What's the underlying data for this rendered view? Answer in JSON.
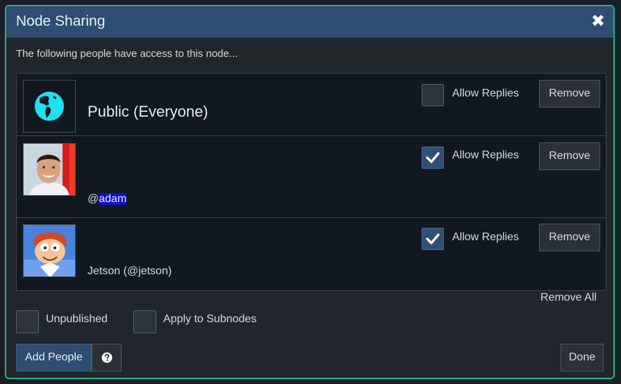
{
  "dialog": {
    "title": "Node Sharing",
    "close_icon": "close-icon",
    "intro": "The following people have access to this node..."
  },
  "shares": [
    {
      "name": "Public (Everyone)",
      "avatar": "globe-icon",
      "allow_replies": false,
      "allow_label": "Allow Replies",
      "remove_label": "Remove"
    },
    {
      "name_prefix": "@",
      "name_highlight": "adam",
      "avatar": "user-photo-adam",
      "allow_replies": true,
      "allow_label": "Allow Replies",
      "remove_label": "Remove"
    },
    {
      "name": "Jetson (@jetson)",
      "avatar": "user-avatar-jetson",
      "allow_replies": true,
      "allow_label": "Allow Replies",
      "remove_label": "Remove"
    }
  ],
  "remove_all_label": "Remove All",
  "options": {
    "unpublished": {
      "label": "Unpublished",
      "checked": false
    },
    "apply_subnodes": {
      "label": "Apply to Subnodes",
      "checked": false
    }
  },
  "footer": {
    "add_people_label": "Add People",
    "help_icon": "help-icon",
    "done_label": "Done"
  },
  "colors": {
    "accent_border": "#22b391",
    "title_bar": "#2f4d70",
    "highlight": "#1111cc",
    "globe": "#20e0f0"
  }
}
